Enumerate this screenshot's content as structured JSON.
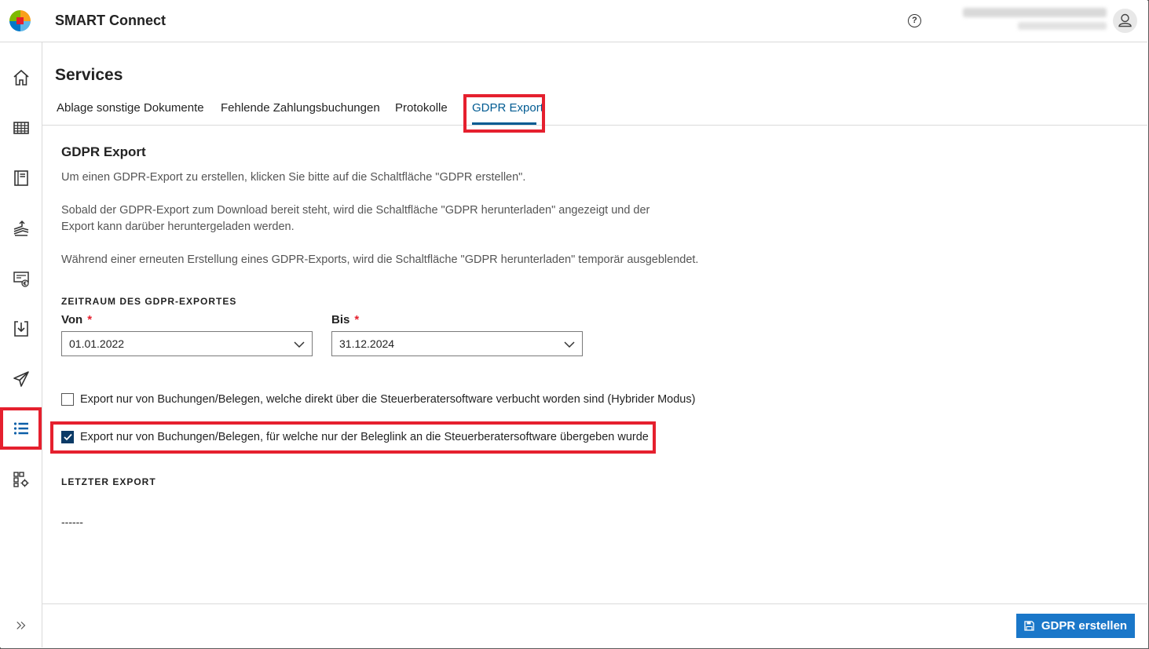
{
  "app": {
    "title": "SMART Connect",
    "help_icon": "?"
  },
  "logo_colors": {
    "tl": "#7fba00",
    "tr": "#f9a11b",
    "bl": "#0078c8",
    "br": "#5eb7e8",
    "center": "#e5202e"
  },
  "sidebar": {
    "items": [
      {
        "name": "home",
        "icon": "home-icon"
      },
      {
        "name": "table",
        "icon": "table-icon"
      },
      {
        "name": "book",
        "icon": "ledger-icon"
      },
      {
        "name": "stack",
        "icon": "stack-upload-icon"
      },
      {
        "name": "invoice",
        "icon": "euro-invoice-icon"
      },
      {
        "name": "download",
        "icon": "download-icon"
      },
      {
        "name": "send",
        "icon": "send-icon"
      },
      {
        "name": "services",
        "icon": "list-icon",
        "active": true
      },
      {
        "name": "settings",
        "icon": "settings-grid-icon"
      }
    ],
    "expand_icon": "expand-icon"
  },
  "page": {
    "title": "Services"
  },
  "tabs": [
    {
      "label": "Ablage sonstige Dokumente"
    },
    {
      "label": "Fehlende Zahlungsbuchungen"
    },
    {
      "label": "Protokolle"
    },
    {
      "label": "GDPR Export",
      "active": true
    }
  ],
  "section": {
    "title": "GDPR Export",
    "para1": "Um einen GDPR-Export zu erstellen, klicken Sie bitte auf die Schaltfläche \"GDPR erstellen\".",
    "para2": "Sobald der GDPR-Export zum Download bereit steht, wird die Schaltfläche \"GDPR herunterladen\" angezeigt und der Export kann darüber heruntergeladen werden.",
    "para3": "Während einer erneuten Erstellung eines GDPR-Exports, wird die Schaltfläche \"GDPR herunterladen\" temporär ausgeblendet."
  },
  "period": {
    "heading": "ZEITRAUM DES GDPR-EXPORTES",
    "from_label": "Von",
    "to_label": "Bis",
    "required_mark": "*",
    "from_value": "01.01.2022",
    "to_value": "31.12.2024"
  },
  "options": {
    "hybrid": {
      "label": "Export nur von Buchungen/Belegen, welche direkt über die Steuerberatersoftware verbucht worden sind (Hybrider Modus)",
      "checked": false
    },
    "beleglink": {
      "label": "Export nur von Buchungen/Belegen, für welche nur der Beleglink an die Steuerberatersoftware übergeben wurde",
      "checked": true
    }
  },
  "last_export": {
    "heading": "LETZTER EXPORT",
    "value": "------"
  },
  "footer": {
    "primary_label": "GDPR erstellen",
    "primary_icon": "save-icon"
  },
  "colors": {
    "accent": "#005b92",
    "button": "#1a77c9",
    "highlight": "#e5202e",
    "checkbox": "#0b3a66"
  }
}
